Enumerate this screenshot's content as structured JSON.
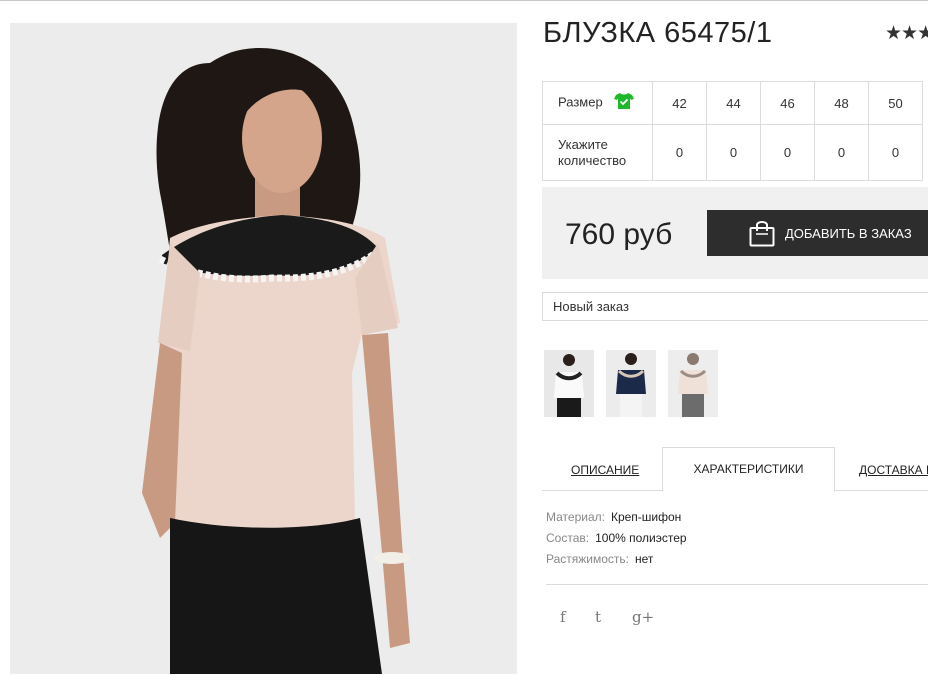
{
  "product": {
    "title": "БЛУЗКА 65475/1",
    "rating_stars": "★★★"
  },
  "sizes": {
    "size_label": "Размер",
    "qty_label": "Укажите количество",
    "values": [
      "42",
      "44",
      "46",
      "48",
      "50"
    ],
    "quantities": [
      "0",
      "0",
      "0",
      "0",
      "0"
    ]
  },
  "purchase": {
    "price": "760 руб",
    "add_button": "ДОБАВИТЬ В ЗАКАЗ",
    "order_select": "Новый заказ"
  },
  "tabs": [
    "ОПИСАНИЕ",
    "ХАРАКТЕРИСТИКИ",
    "ДОСТАВКА И"
  ],
  "specs": [
    {
      "key": "Материал:",
      "value": "Креп-шифон"
    },
    {
      "key": "Состав:",
      "value": "100% полиэстер"
    },
    {
      "key": "Растяжимость:",
      "value": "нет"
    }
  ],
  "social": [
    "f",
    "t",
    "g+"
  ],
  "colors": {
    "accent_green": "#1fb82a",
    "button_dark": "#2d2d2d",
    "blouse": "#ecd6cc"
  }
}
